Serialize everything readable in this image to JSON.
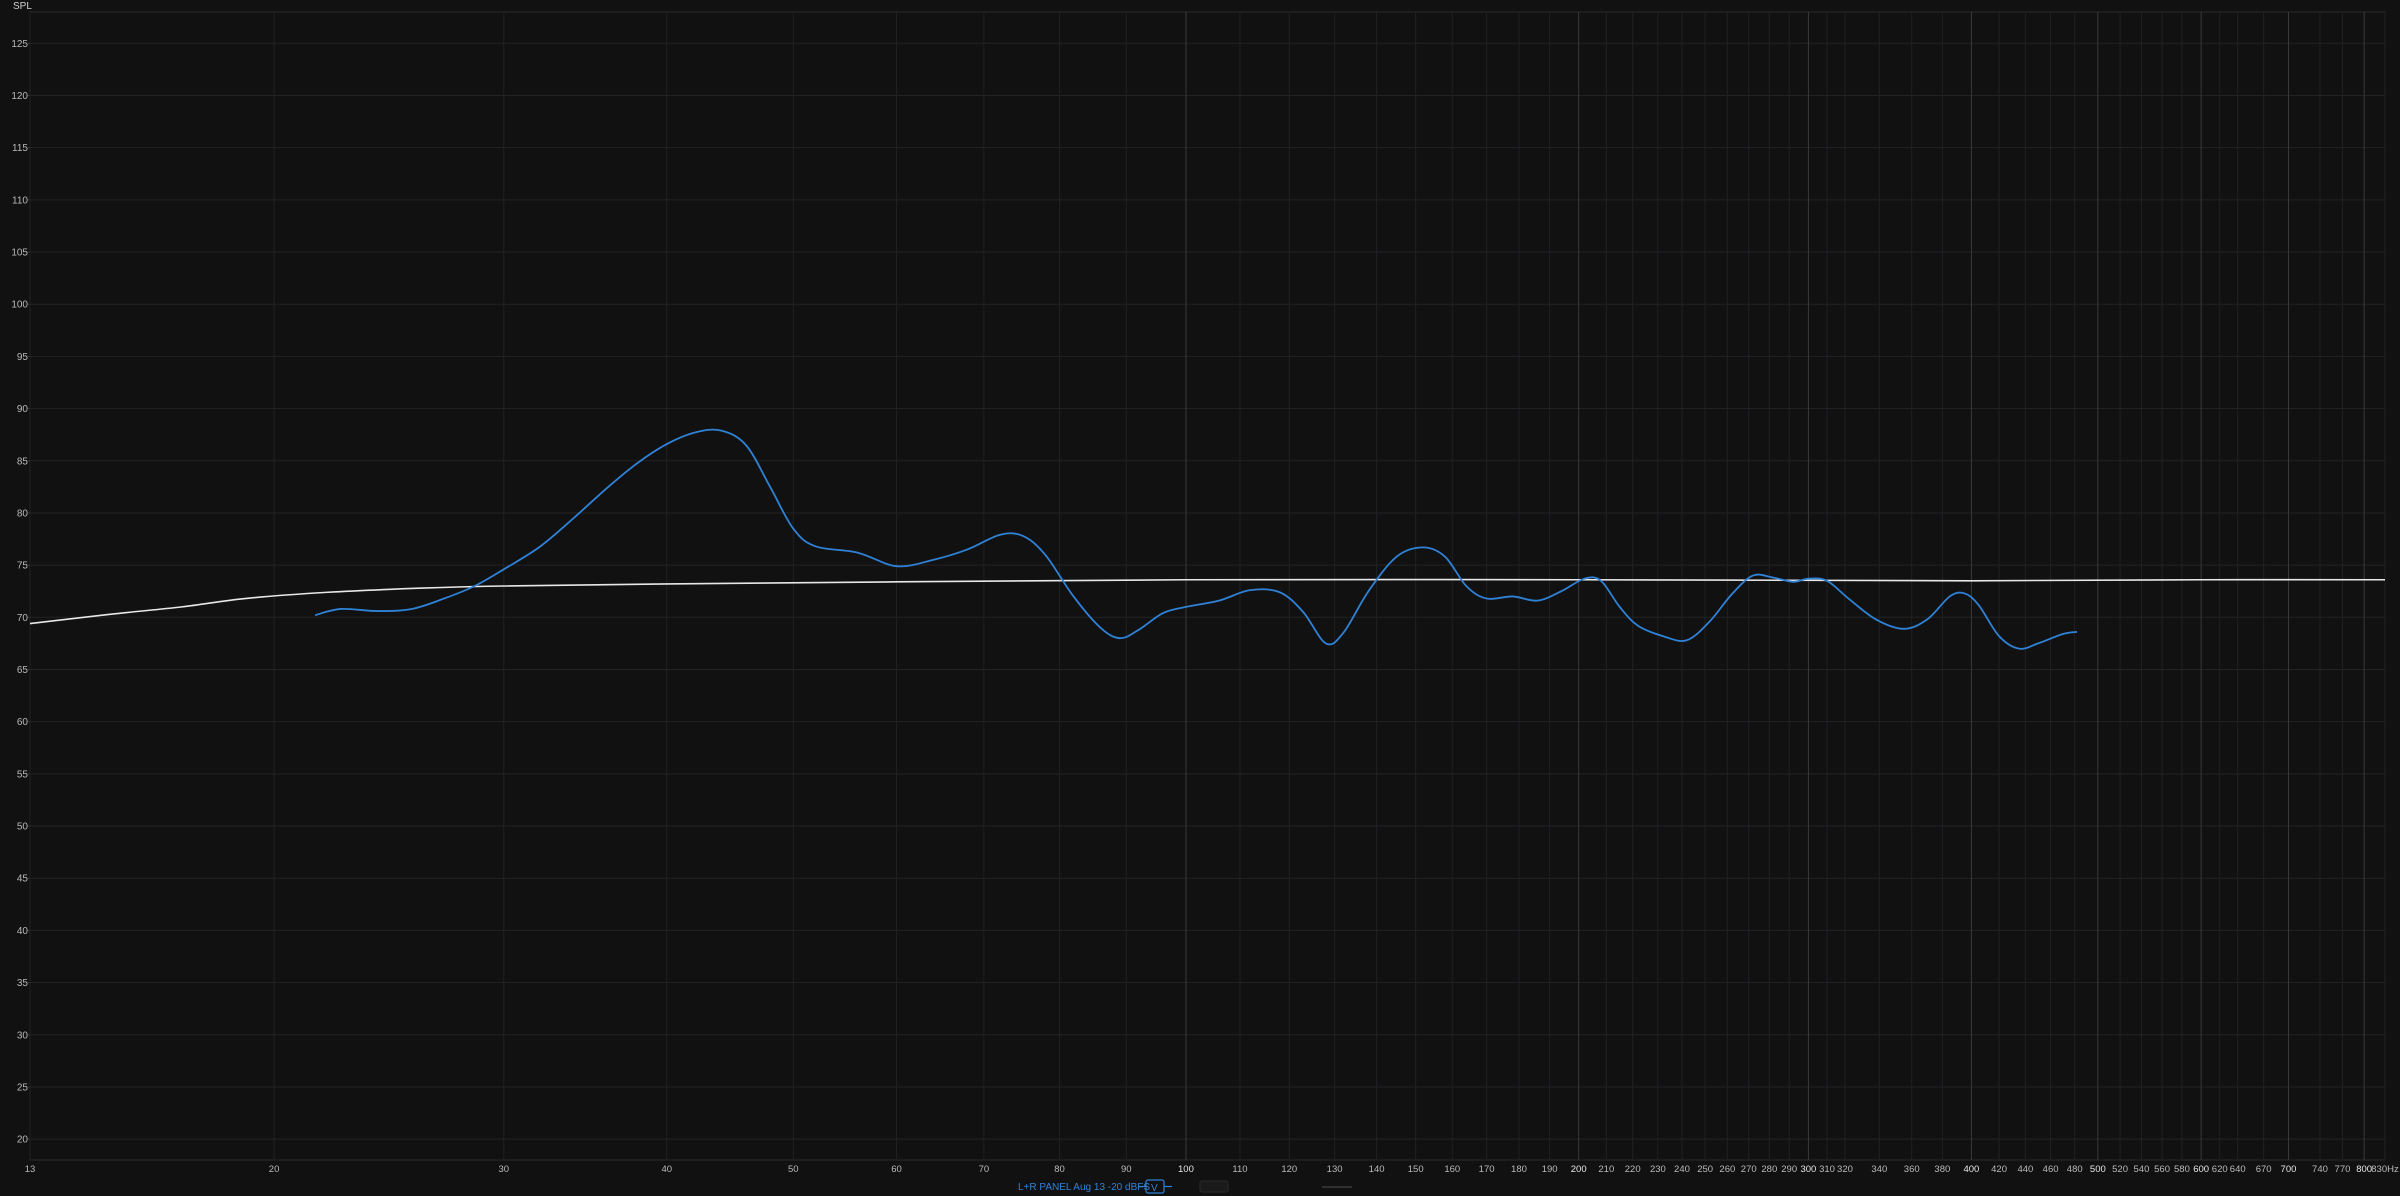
{
  "chart_data": {
    "type": "line",
    "title": "",
    "ylabel": "SPL",
    "xunit": "Hz",
    "xscale": "log",
    "xlim": [
      13,
      830
    ],
    "ylim": [
      18,
      128
    ],
    "grid": true,
    "y_ticks": [
      20,
      25,
      30,
      35,
      40,
      45,
      50,
      55,
      60,
      65,
      70,
      75,
      80,
      85,
      90,
      95,
      100,
      105,
      110,
      115,
      120,
      125
    ],
    "x_ticks": [
      {
        "v": 13,
        "t": "13"
      },
      {
        "v": 20,
        "t": "20"
      },
      {
        "v": 30,
        "t": "30"
      },
      {
        "v": 40,
        "t": "40"
      },
      {
        "v": 50,
        "t": "50"
      },
      {
        "v": 60,
        "t": "60"
      },
      {
        "v": 70,
        "t": "70"
      },
      {
        "v": 80,
        "t": "80"
      },
      {
        "v": 90,
        "t": "90"
      },
      {
        "v": 100,
        "t": "100",
        "major": true
      },
      {
        "v": 110,
        "t": "110"
      },
      {
        "v": 120,
        "t": "120"
      },
      {
        "v": 130,
        "t": "130"
      },
      {
        "v": 140,
        "t": "140"
      },
      {
        "v": 150,
        "t": "150"
      },
      {
        "v": 160,
        "t": "160"
      },
      {
        "v": 170,
        "t": "170"
      },
      {
        "v": 180,
        "t": "180"
      },
      {
        "v": 190,
        "t": "190"
      },
      {
        "v": 200,
        "t": "200",
        "major": true
      },
      {
        "v": 210,
        "t": "210"
      },
      {
        "v": 220,
        "t": "220"
      },
      {
        "v": 230,
        "t": "230"
      },
      {
        "v": 240,
        "t": "240"
      },
      {
        "v": 250,
        "t": "250"
      },
      {
        "v": 260,
        "t": "260"
      },
      {
        "v": 270,
        "t": "270"
      },
      {
        "v": 280,
        "t": "280"
      },
      {
        "v": 290,
        "t": "290"
      },
      {
        "v": 300,
        "t": "300",
        "major": true
      },
      {
        "v": 310,
        "t": "310"
      },
      {
        "v": 320,
        "t": "320"
      },
      {
        "v": 340,
        "t": "340"
      },
      {
        "v": 360,
        "t": "360"
      },
      {
        "v": 380,
        "t": "380"
      },
      {
        "v": 400,
        "t": "400",
        "major": true
      },
      {
        "v": 420,
        "t": "420"
      },
      {
        "v": 440,
        "t": "440"
      },
      {
        "v": 460,
        "t": "460"
      },
      {
        "v": 480,
        "t": "480"
      },
      {
        "v": 500,
        "t": "500",
        "major": true
      },
      {
        "v": 520,
        "t": "520"
      },
      {
        "v": 540,
        "t": "540"
      },
      {
        "v": 560,
        "t": "560"
      },
      {
        "v": 580,
        "t": "580"
      },
      {
        "v": 600,
        "t": "600",
        "major": true
      },
      {
        "v": 620,
        "t": "620"
      },
      {
        "v": 640,
        "t": "640"
      },
      {
        "v": 670,
        "t": "670"
      },
      {
        "v": 700,
        "t": "700",
        "major": true
      },
      {
        "v": 740,
        "t": "740"
      },
      {
        "v": 770,
        "t": "770"
      },
      {
        "v": 800,
        "t": "800",
        "major": true
      },
      {
        "v": 830,
        "t": "830Hz"
      }
    ],
    "series": [
      {
        "name": "L+R PANEL Aug 13 -20 dBFS",
        "color": "#2f82d6",
        "points": [
          [
            21.5,
            70.2
          ],
          [
            22.5,
            70.8
          ],
          [
            24,
            70.6
          ],
          [
            25.5,
            70.8
          ],
          [
            27,
            71.8
          ],
          [
            28.5,
            73.0
          ],
          [
            30,
            74.6
          ],
          [
            32,
            76.8
          ],
          [
            34,
            79.6
          ],
          [
            36,
            82.4
          ],
          [
            38,
            84.8
          ],
          [
            40,
            86.6
          ],
          [
            42,
            87.7
          ],
          [
            44,
            87.9
          ],
          [
            46,
            86.5
          ],
          [
            48,
            82.5
          ],
          [
            50,
            78.5
          ],
          [
            52,
            76.8
          ],
          [
            56,
            76.2
          ],
          [
            60,
            74.9
          ],
          [
            64,
            75.5
          ],
          [
            68,
            76.5
          ],
          [
            72,
            77.9
          ],
          [
            75,
            77.8
          ],
          [
            78,
            76.0
          ],
          [
            82,
            72.0
          ],
          [
            86,
            69.0
          ],
          [
            89,
            68.0
          ],
          [
            92,
            68.8
          ],
          [
            96,
            70.4
          ],
          [
            100,
            71.0
          ],
          [
            106,
            71.6
          ],
          [
            112,
            72.6
          ],
          [
            118,
            72.4
          ],
          [
            123,
            70.5
          ],
          [
            128,
            67.5
          ],
          [
            132,
            68.5
          ],
          [
            138,
            72.5
          ],
          [
            145,
            75.8
          ],
          [
            152,
            76.7
          ],
          [
            158,
            75.8
          ],
          [
            164,
            73.0
          ],
          [
            170,
            71.8
          ],
          [
            178,
            72.0
          ],
          [
            186,
            71.6
          ],
          [
            194,
            72.5
          ],
          [
            202,
            73.7
          ],
          [
            208,
            73.5
          ],
          [
            215,
            71.0
          ],
          [
            222,
            69.2
          ],
          [
            232,
            68.2
          ],
          [
            242,
            67.8
          ],
          [
            252,
            69.6
          ],
          [
            262,
            72.2
          ],
          [
            272,
            74.0
          ],
          [
            282,
            73.8
          ],
          [
            292,
            73.4
          ],
          [
            300,
            73.7
          ],
          [
            310,
            73.5
          ],
          [
            322,
            71.8
          ],
          [
            338,
            69.8
          ],
          [
            355,
            68.9
          ],
          [
            370,
            69.8
          ],
          [
            385,
            72.0
          ],
          [
            395,
            72.3
          ],
          [
            405,
            71.2
          ],
          [
            420,
            68.2
          ],
          [
            435,
            67.0
          ],
          [
            450,
            67.5
          ],
          [
            470,
            68.4
          ],
          [
            482,
            68.6
          ]
        ]
      },
      {
        "name": "",
        "color": "#e8e8e8",
        "points": [
          [
            13,
            69.4
          ],
          [
            15,
            70.3
          ],
          [
            17,
            71.0
          ],
          [
            19,
            71.8
          ],
          [
            22,
            72.4
          ],
          [
            26,
            72.8
          ],
          [
            30,
            73.0
          ],
          [
            40,
            73.2
          ],
          [
            60,
            73.4
          ],
          [
            100,
            73.6
          ],
          [
            200,
            73.6
          ],
          [
            400,
            73.5
          ],
          [
            600,
            73.6
          ],
          [
            830,
            73.6
          ]
        ]
      }
    ],
    "legend": {
      "position": "bottom-center",
      "label": "L+R PANEL Aug 13 -20 dBFS",
      "buttons": [
        "V",
        "",
        ""
      ]
    }
  }
}
